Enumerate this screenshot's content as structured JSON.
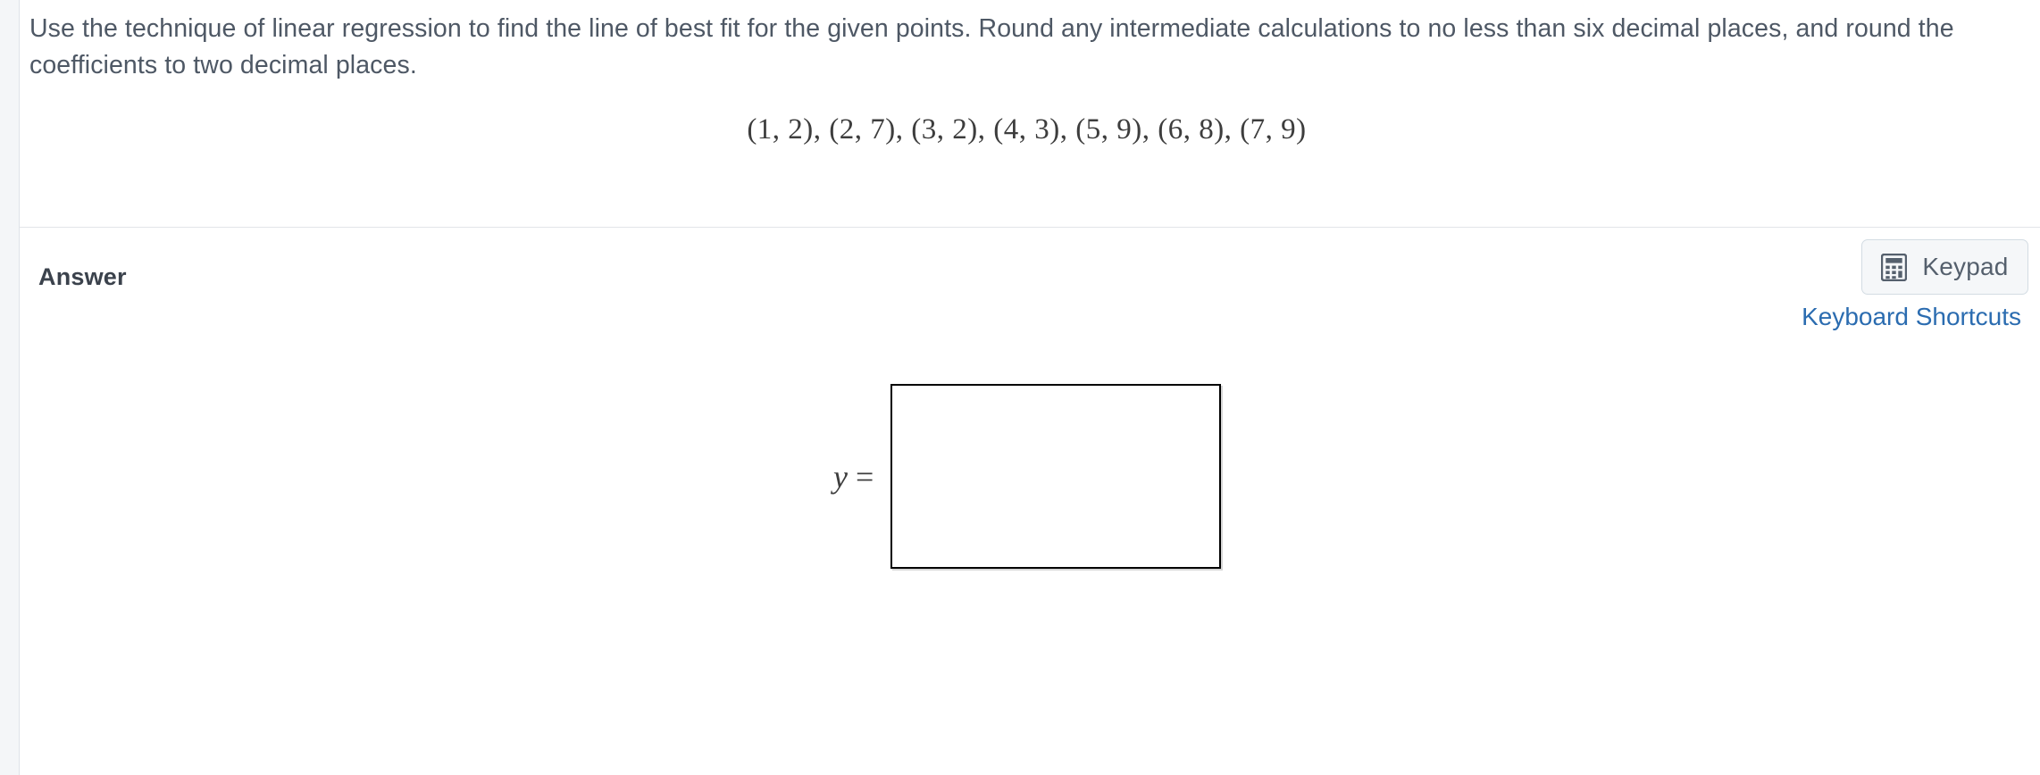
{
  "question": {
    "prompt": "Use the technique of linear regression to find the line of best fit for the given points. Round any intermediate calculations to no less than six decimal places, and round the coefficients to two decimal places.",
    "points_expression": "(1, 2), (2, 7), (3, 2), (4, 3), (5, 9), (6, 8), (7, 9)"
  },
  "answer": {
    "section_label": "Answer",
    "equation_prefix_variable": "y",
    "equation_prefix_operator": "=",
    "input_value": "",
    "input_placeholder": ""
  },
  "toolbar": {
    "keypad_label": "Keypad",
    "keypad_icon": "calculator-icon",
    "keyboard_shortcuts_label": "Keyboard Shortcuts"
  },
  "colors": {
    "link": "#2b6cb0",
    "body_text": "#4e5865",
    "heading_text": "#3b424c",
    "page_background": "#f4f6f8",
    "card_background": "#ffffff",
    "divider": "#e2e5e9",
    "button_background": "#f5f7f9",
    "button_border": "#d3dce3",
    "input_border": "#000000"
  }
}
